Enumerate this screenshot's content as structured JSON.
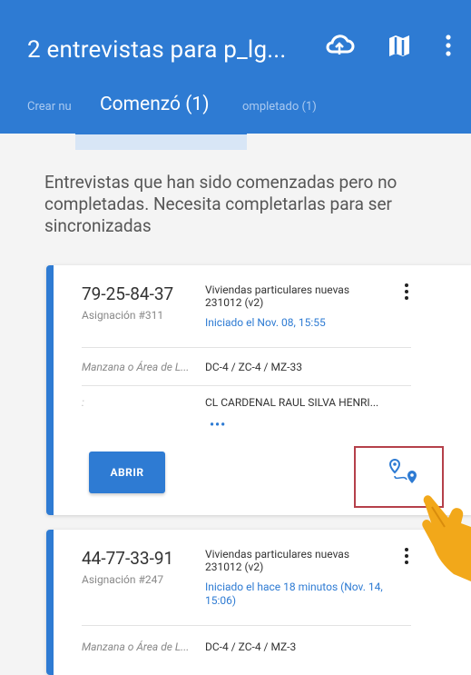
{
  "header": {
    "title": "2 entrevistas para p_lg...",
    "icons": [
      "cloud-sync-icon",
      "map-icon",
      "overflow-menu-icon"
    ]
  },
  "tabs": [
    {
      "label": "Crear nu"
    },
    {
      "label": "Comenzó (1)"
    },
    {
      "label": "ompletado (1)"
    }
  ],
  "intro_text": "Entrevistas que han sido comenzadas pero no completadas. Necesita completarlas para ser sincronizadas",
  "cards": [
    {
      "key": "79-25-84-37",
      "assignment": "Asignación #311",
      "questionnaire": "Viviendas particulares nuevas 231012 (v2)",
      "status": "Iniciado el Nov. 08, 15:55",
      "field1_label": "Manzana o Área de L...",
      "field1_value": "DC-4 / ZC-4 / MZ-33",
      "field2_label": ":",
      "field2_value": "CL CARDENAL RAUL SILVA HENRI...",
      "more": "•••",
      "open_label": "ABRIR"
    },
    {
      "key": "44-77-33-91",
      "assignment": "Asignación #247",
      "questionnaire": "Viviendas particulares nuevas 231012 (v2)",
      "status": "Iniciado el hace 18 minutos (Nov. 14, 15:06)",
      "field1_label": "Manzana o Área de L...",
      "field1_value": "DC-4 / ZC-4 / MZ-3"
    }
  ],
  "colors": {
    "primary": "#2e7bd3",
    "highlight_border": "#b5404a",
    "hand": "#f2a81a"
  }
}
